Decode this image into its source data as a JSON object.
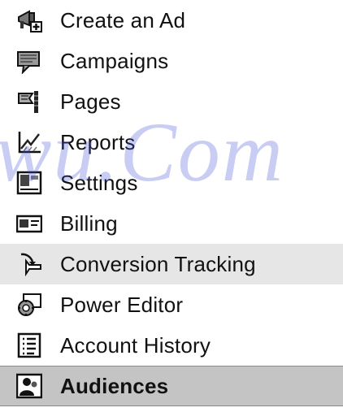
{
  "menu": {
    "items": [
      {
        "label": "Create an Ad",
        "icon": "create-ad-icon"
      },
      {
        "label": "Campaigns",
        "icon": "campaigns-icon"
      },
      {
        "label": "Pages",
        "icon": "pages-icon"
      },
      {
        "label": "Reports",
        "icon": "reports-icon"
      },
      {
        "label": "Settings",
        "icon": "settings-icon"
      },
      {
        "label": "Billing",
        "icon": "billing-icon"
      },
      {
        "label": "Conversion Tracking",
        "icon": "conversion-tracking-icon",
        "state": "hover"
      },
      {
        "label": "Power Editor",
        "icon": "power-editor-icon"
      },
      {
        "label": "Account History",
        "icon": "account-history-icon"
      },
      {
        "label": "Audiences",
        "icon": "audiences-icon",
        "state": "active"
      }
    ]
  },
  "watermark": "wu.Com",
  "colors": {
    "hover_bg": "#e6e6e6",
    "active_bg": "#c4c4c4",
    "watermark": "#3f4fd8",
    "text": "#111111"
  }
}
